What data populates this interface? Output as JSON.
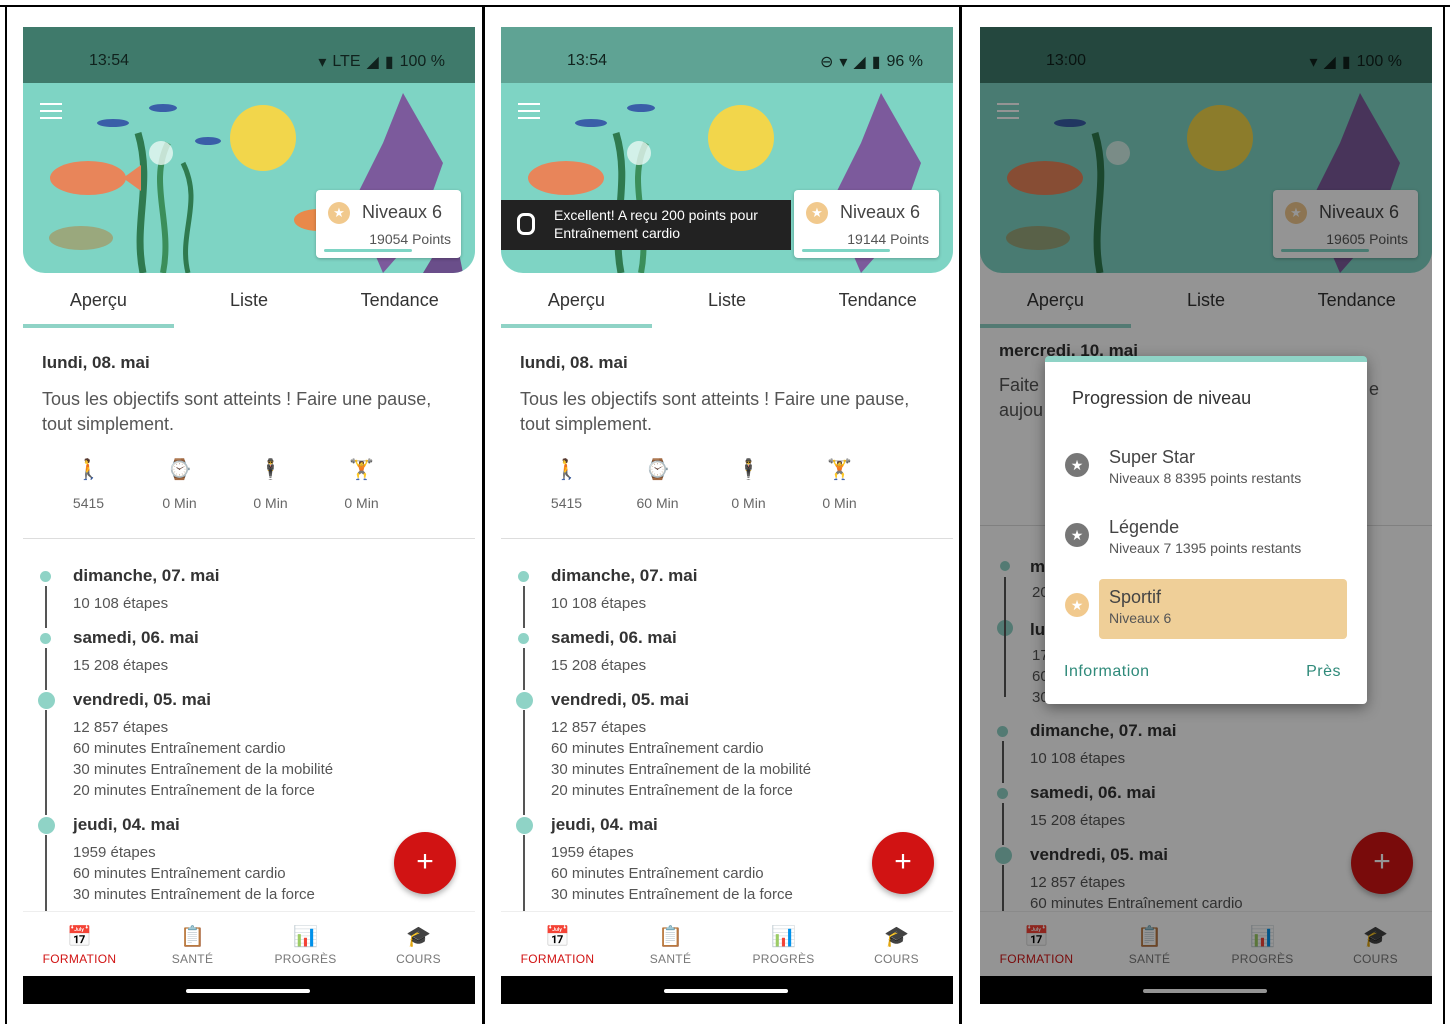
{
  "colors": {
    "accent": "#8fd3c6",
    "brand_red": "#d11313",
    "hero_bg": "#7ed4c4",
    "status_bg": "#3f7a6b",
    "gold": "#efcf98"
  },
  "tabs": [
    "Aperçu",
    "Liste",
    "Tendance"
  ],
  "nav": [
    {
      "label": "FORMATION",
      "icon": "calendar-icon"
    },
    {
      "label": "SANTÉ",
      "icon": "clipboard-icon"
    },
    {
      "label": "PROGRÈS",
      "icon": "chart-icon"
    },
    {
      "label": "COURS",
      "icon": "graduation-cap-icon"
    }
  ],
  "screens": [
    {
      "status": {
        "time": "13:54",
        "network": "LTE",
        "battery": "100 %"
      },
      "level": {
        "label": "Niveaux 6",
        "points": "19054 Points"
      },
      "day": {
        "date": "lundi, 08. mai",
        "message": "Tous les objectifs sont atteints ! Faire une pause, tout simplement."
      },
      "metrics": [
        "5415",
        "0 Min",
        "0 Min",
        "0 Min"
      ],
      "timeline": [
        {
          "date": "dimanche, 07. mai",
          "lines": [
            "10 108 étapes"
          ]
        },
        {
          "date": "samedi, 06. mai",
          "lines": [
            "15 208 étapes"
          ]
        },
        {
          "date": "vendredi, 05. mai",
          "lines": [
            "12 857 étapes",
            "60 minutes Entraînement cardio",
            "30 minutes Entraînement de la mobilité",
            "20 minutes Entraînement de la force"
          ]
        },
        {
          "date": "jeudi, 04. mai",
          "lines": [
            "1959 étapes",
            "60 minutes Entraînement cardio",
            "30 minutes Entraînement de la force"
          ]
        }
      ]
    },
    {
      "status": {
        "time": "13:54",
        "battery": "96 %"
      },
      "level": {
        "label": "Niveaux 6",
        "points": "19144 Points"
      },
      "toast": "Excellent! A reçu 200 points pour Entraînement cardio",
      "day": {
        "date": "lundi, 08. mai",
        "message": "Tous les objectifs sont atteints ! Faire une pause, tout simplement."
      },
      "metrics": [
        "5415",
        "60 Min",
        "0 Min",
        "0 Min"
      ],
      "timeline": [
        {
          "date": "dimanche, 07. mai",
          "lines": [
            "10 108 étapes"
          ]
        },
        {
          "date": "samedi, 06. mai",
          "lines": [
            "15 208 étapes"
          ]
        },
        {
          "date": "vendredi, 05. mai",
          "lines": [
            "12 857 étapes",
            "60 minutes Entraînement cardio",
            "30 minutes Entraînement de la mobilité",
            "20 minutes Entraînement de la force"
          ]
        },
        {
          "date": "jeudi, 04. mai",
          "lines": [
            "1959 étapes",
            "60 minutes Entraînement cardio",
            "30 minutes Entraînement de la force"
          ]
        }
      ]
    },
    {
      "status": {
        "time": "13:00",
        "battery": "100 %"
      },
      "level": {
        "label": "Niveaux 6",
        "points": "19605 Points"
      },
      "day": {
        "date": "mercredi, 10. mai",
        "message_fragments": [
          "Faite",
          "aujou",
          "e"
        ]
      },
      "behind_letters": [
        "m",
        "20",
        "lu",
        "17",
        "60",
        "30"
      ],
      "timeline": [
        {
          "date": "dimanche, 07. mai",
          "lines": [
            "10 108 étapes"
          ]
        },
        {
          "date": "samedi, 06. mai",
          "lines": [
            "15 208 étapes"
          ]
        },
        {
          "date": "vendredi, 05. mai",
          "lines": [
            "12 857 étapes",
            "60 minutes Entraînement cardio"
          ]
        }
      ],
      "dialog": {
        "title": "Progression de niveau",
        "items": [
          {
            "name": "Super Star",
            "meta": "Niveaux 8  8395 points restants",
            "selected": false
          },
          {
            "name": "Légende",
            "meta": "Niveaux 7   1395 points restants",
            "selected": false
          },
          {
            "name": "Sportif",
            "meta": "Niveaux 6",
            "selected": true
          }
        ],
        "info_label": "Information",
        "close_label": "Près"
      }
    }
  ]
}
